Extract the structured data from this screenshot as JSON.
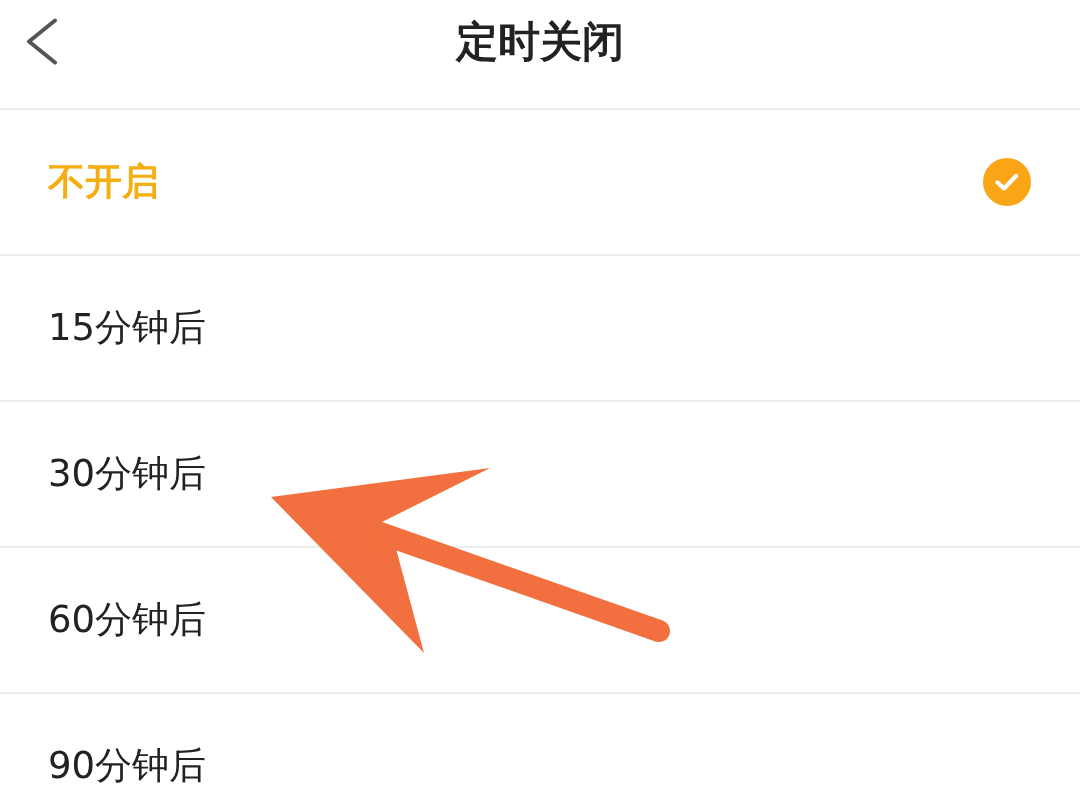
{
  "header": {
    "title": "定时关闭"
  },
  "options": [
    {
      "label": "不开启",
      "selected": true
    },
    {
      "label": "15分钟后",
      "selected": false
    },
    {
      "label": "30分钟后",
      "selected": false
    },
    {
      "label": "60分钟后",
      "selected": false
    },
    {
      "label": "90分钟后",
      "selected": false
    }
  ]
}
